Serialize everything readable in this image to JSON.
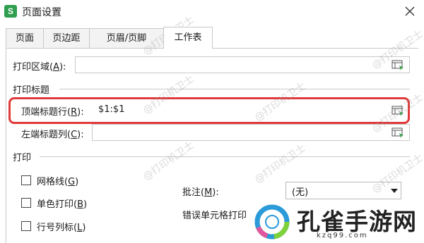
{
  "window": {
    "app_icon_letter": "S",
    "title": "页面设置",
    "close_icon": "close-icon"
  },
  "tabs": [
    {
      "label": "页面",
      "active": false
    },
    {
      "label": "页边距",
      "active": false
    },
    {
      "label": "页眉/页脚",
      "active": false
    },
    {
      "label": "工作表",
      "active": true
    }
  ],
  "print_area": {
    "label_prefix": "打印区域(",
    "label_key": "A",
    "label_suffix": "):",
    "value": ""
  },
  "print_titles": {
    "section_label": "打印标题",
    "top_rows": {
      "label_prefix": "顶端标题行(",
      "label_key": "R",
      "label_suffix": "):",
      "value": "$1:$1"
    },
    "left_cols": {
      "label_prefix": "左端标题列(",
      "label_key": "C",
      "label_suffix": "):",
      "value": ""
    }
  },
  "print": {
    "section_label": "打印",
    "gridlines": {
      "label_prefix": "网格线(",
      "label_key": "G",
      "label_suffix": ")",
      "checked": false
    },
    "mono": {
      "label_prefix": "单色打印(",
      "label_key": "B",
      "label_suffix": ")",
      "checked": false
    },
    "headings": {
      "label_prefix": "行号列标(",
      "label_key": "L",
      "label_suffix": ")",
      "checked": false
    },
    "comments": {
      "label_prefix": "批注(",
      "label_key": "M",
      "label_suffix": "):",
      "value": "(无)"
    },
    "errors": {
      "label": "错误单元格打印"
    }
  },
  "watermark_text": "@打印机卫士",
  "logo": {
    "text": "孔雀手游网",
    "url": "kzq99.com",
    "accent": "#2b9ad8"
  },
  "colors": {
    "highlight": "#e03a3a",
    "app_icon": "#2e9e4f",
    "picker_icon": "#3aa34a"
  }
}
